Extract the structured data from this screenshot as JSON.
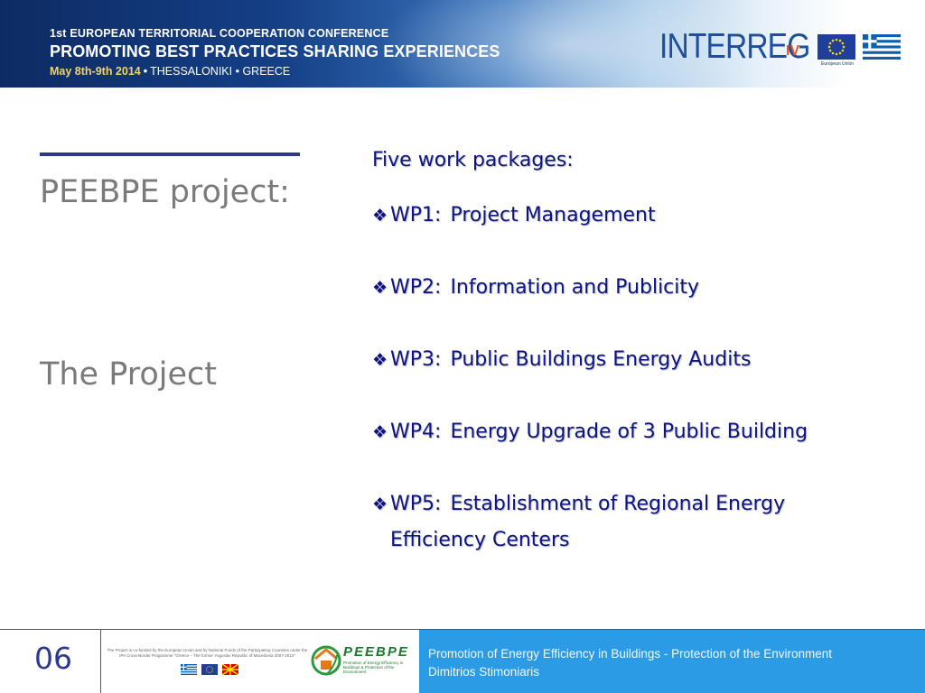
{
  "banner": {
    "conference_line": "1st EUROPEAN TERRITORIAL COOPERATION CONFERENCE",
    "conference_title": "PROMOTING BEST PRACTICES SHARING EXPERIENCES",
    "dates": "May 8th-9th 2014",
    "location": "THESSALONIKI • GREECE",
    "separator": "•",
    "interreg_word": "INTERREG",
    "interreg_roman": "IV",
    "eu_caption": "European Union"
  },
  "slide": {
    "title": "PEEBPE project:",
    "subtitle": "The Project",
    "heading": "Five work packages:",
    "bullet_symbol": "❖",
    "work_packages": [
      {
        "code": "WP1:",
        "label": "Project Management",
        "continuation": ""
      },
      {
        "code": "WP2:",
        "label": "Information and Publicity",
        "continuation": ""
      },
      {
        "code": "WP3:",
        "label": "Public Buildings Energy Audits",
        "continuation": ""
      },
      {
        "code": "WP4:",
        "label": "Energy Upgrade of 3 Public Building",
        "continuation": ""
      },
      {
        "code": "WP5:",
        "label": "Establishment of Regional Energy",
        "continuation": "Efficiency Centers"
      }
    ]
  },
  "footer": {
    "page_number": "06",
    "cofund_text": "The Project is co-funded by the European Union and by National Funds of the Participating Countries under the IPA Cross-Border Programme \"Greece – The former Yugoslav Republic of Macedonia 2007-2013\"",
    "logo_word": "PEEBPE",
    "logo_tagline": "Promotion of Energy Efficiency in Buildings & Protection of the Environment",
    "project_line": "Promotion of Energy Efficiency in Buildings - Protection of the Environment",
    "author": "Dimitrios Stimoniaris"
  },
  "colors": {
    "heading_text": "#0b1480",
    "title_text": "#7a7a7a",
    "title_rule": "#2b3a8c",
    "footer_box": "#2c9be6",
    "banner_dark": "#0d2b63",
    "date_accent": "#f0d36a"
  }
}
